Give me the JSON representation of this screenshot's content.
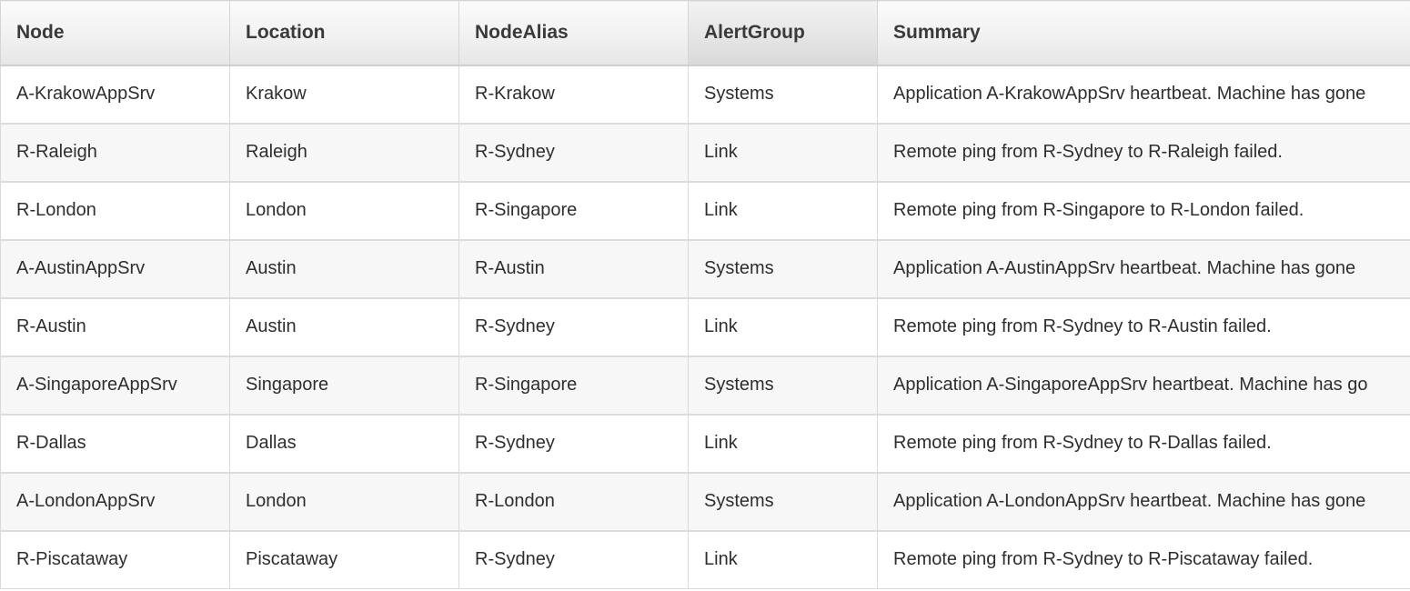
{
  "grid": {
    "columns": [
      {
        "key": "node",
        "label": "Node"
      },
      {
        "key": "location",
        "label": "Location"
      },
      {
        "key": "nodealias",
        "label": "NodeAlias"
      },
      {
        "key": "alertgroup",
        "label": "AlertGroup"
      },
      {
        "key": "summary",
        "label": "Summary"
      }
    ],
    "rows": [
      {
        "node": "A-KrakowAppSrv",
        "location": "Krakow",
        "nodealias": "R-Krakow",
        "alertgroup": "Systems",
        "summary": "Application A-KrakowAppSrv heartbeat. Machine has gone"
      },
      {
        "node": "R-Raleigh",
        "location": "Raleigh",
        "nodealias": "R-Sydney",
        "alertgroup": "Link",
        "summary": "Remote ping from R-Sydney to R-Raleigh failed."
      },
      {
        "node": "R-London",
        "location": "London",
        "nodealias": "R-Singapore",
        "alertgroup": "Link",
        "summary": "Remote ping from R-Singapore to R-London failed."
      },
      {
        "node": "A-AustinAppSrv",
        "location": "Austin",
        "nodealias": "R-Austin",
        "alertgroup": "Systems",
        "summary": "Application A-AustinAppSrv heartbeat. Machine has gone"
      },
      {
        "node": "R-Austin",
        "location": "Austin",
        "nodealias": "R-Sydney",
        "alertgroup": "Link",
        "summary": "Remote ping from R-Sydney to R-Austin failed."
      },
      {
        "node": "A-SingaporeAppSrv",
        "location": "Singapore",
        "nodealias": "R-Singapore",
        "alertgroup": "Systems",
        "summary": "Application A-SingaporeAppSrv heartbeat. Machine has go"
      },
      {
        "node": "R-Dallas",
        "location": "Dallas",
        "nodealias": "R-Sydney",
        "alertgroup": "Link",
        "summary": "Remote ping from R-Sydney to R-Dallas failed."
      },
      {
        "node": "A-LondonAppSrv",
        "location": "London",
        "nodealias": "R-London",
        "alertgroup": "Systems",
        "summary": "Application A-LondonAppSrv heartbeat. Machine has gone"
      },
      {
        "node": "R-Piscataway",
        "location": "Piscataway",
        "nodealias": "R-Sydney",
        "alertgroup": "Link",
        "summary": "Remote ping from R-Sydney to R-Piscataway failed."
      }
    ]
  }
}
